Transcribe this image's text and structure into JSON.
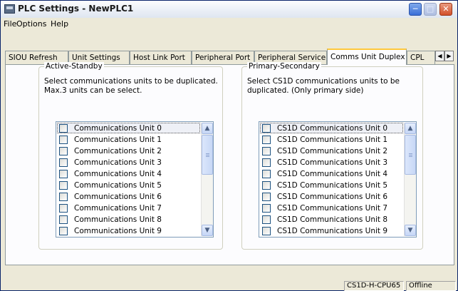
{
  "window": {
    "title": "PLC Settings - NewPLC1"
  },
  "menu": [
    "File",
    "Options",
    "Help"
  ],
  "tabs": [
    {
      "label": "SIOU Refresh"
    },
    {
      "label": "Unit Settings"
    },
    {
      "label": "Host Link Port"
    },
    {
      "label": "Peripheral Port"
    },
    {
      "label": "Peripheral Service"
    },
    {
      "label": "Comms Unit Duplex"
    },
    {
      "label": "CPL"
    }
  ],
  "active_tab": "Comms Unit Duplex",
  "left_group": {
    "label": "Active-Standby",
    "desc_line1": "Select communications units to be duplicated.",
    "desc_line2": "Max.3 units can be select.",
    "items": [
      "Communications Unit 0",
      "Communications Unit 1",
      "Communications Unit 2",
      "Communications Unit 3",
      "Communications Unit 4",
      "Communications Unit 5",
      "Communications Unit 6",
      "Communications Unit 7",
      "Communications Unit 8",
      "Communications Unit 9"
    ]
  },
  "right_group": {
    "label": "Primary-Secondary",
    "desc_line1": "Select CS1D communications units to be",
    "desc_line2": "duplicated. (Only primary side)",
    "items": [
      "CS1D Communications Unit 0",
      "CS1D Communications Unit 1",
      "CS1D Communications Unit 2",
      "CS1D Communications Unit 3",
      "CS1D Communications Unit 4",
      "CS1D Communications Unit 5",
      "CS1D Communications Unit 6",
      "CS1D Communications Unit 7",
      "CS1D Communications Unit 8",
      "CS1D Communications Unit 9"
    ]
  },
  "status": {
    "model": "CS1D-H-CPU65",
    "mode": "Offline"
  },
  "icons": {
    "app": "plc-app-icon",
    "minimize": "minimize-icon",
    "maximize": "maximize-icon",
    "close": "close-icon",
    "tab_left": "chevron-left-icon",
    "tab_right": "chevron-right-icon"
  }
}
